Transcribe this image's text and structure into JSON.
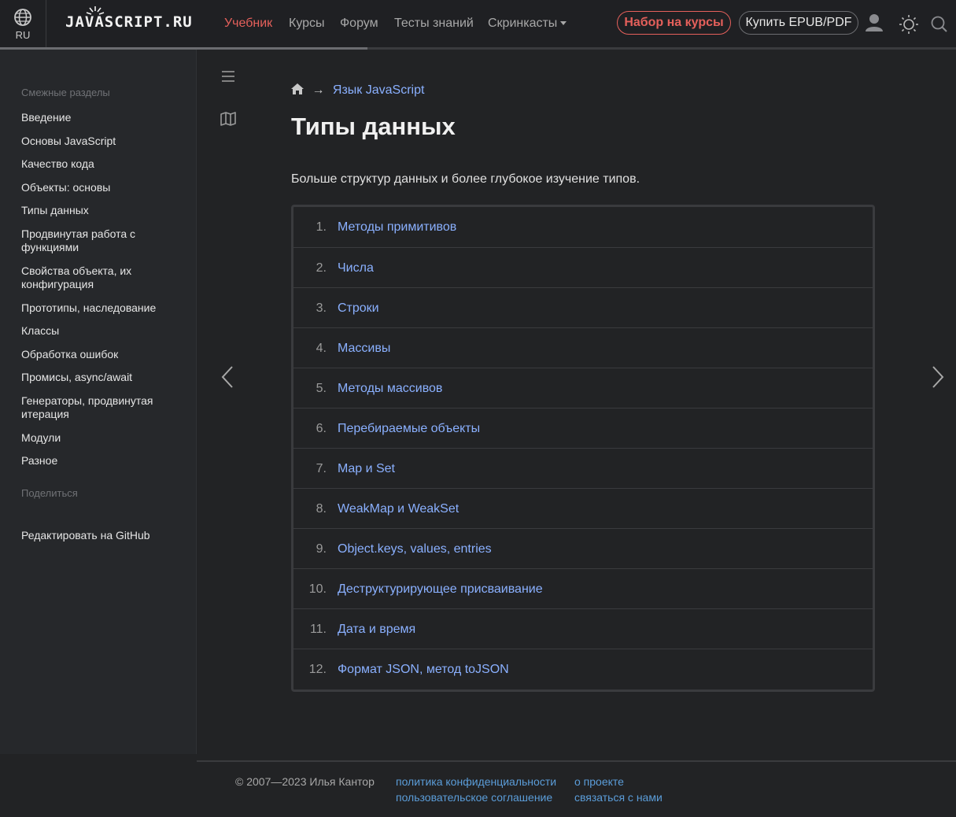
{
  "header": {
    "lang_code": "RU",
    "logo_text": "JAVASCRIPT.RU",
    "nav": [
      {
        "label": "Учебник",
        "active": true
      },
      {
        "label": "Курсы"
      },
      {
        "label": "Форум"
      },
      {
        "label": "Тесты знаний"
      },
      {
        "label": "Скринкасты"
      }
    ],
    "courses_button": "Набор на курсы",
    "buy_button": "Купить EPUB/PDF",
    "icons": [
      "globe-icon",
      "user-icon",
      "theme-sun-icon",
      "search-icon"
    ],
    "accent_color": "#e5605b"
  },
  "sidebar": {
    "related_title": "Смежные разделы",
    "items": [
      "Введение",
      "Основы JavaScript",
      "Качество кода",
      "Объекты: основы",
      "Типы данных",
      "Продвинутая работа с функциями",
      "Свойства объекта, их конфигурация",
      "Прототипы, наследование",
      "Классы",
      "Обработка ошибок",
      "Промисы, async/await",
      "Генераторы, продвинутая итерация",
      "Модули",
      "Разное"
    ],
    "share_title": "Поделиться",
    "edit_link": "Редактировать на GitHub"
  },
  "tools": {
    "icons": [
      "menu-icon",
      "map-icon",
      "prev-arrow-icon",
      "next-arrow-icon"
    ]
  },
  "main": {
    "breadcrumb": {
      "home_icon": "home-icon",
      "separator": "→",
      "link": "Язык JavaScript"
    },
    "title": "Типы данных",
    "intro": "Больше структур данных и более глубокое изучение типов.",
    "link_color": "#8ab0ff",
    "toc": [
      {
        "num": "1.",
        "label": "Методы примитивов"
      },
      {
        "num": "2.",
        "label": "Числа"
      },
      {
        "num": "3.",
        "label": "Строки"
      },
      {
        "num": "4.",
        "label": "Массивы"
      },
      {
        "num": "5.",
        "label": "Методы массивов"
      },
      {
        "num": "6.",
        "label": "Перебираемые объекты"
      },
      {
        "num": "7.",
        "label": "Map и Set"
      },
      {
        "num": "8.",
        "label": "WeakMap и WeakSet"
      },
      {
        "num": "9.",
        "label": "Object.keys, values, entries"
      },
      {
        "num": "10.",
        "label": "Деструктурирующее присваивание"
      },
      {
        "num": "11.",
        "label": "Дата и время"
      },
      {
        "num": "12.",
        "label": "Формат JSON, метод toJSON"
      }
    ]
  },
  "footer": {
    "copyright": "© 2007—2023  Илья Кантор",
    "links": [
      "политика конфиденциальности",
      "пользовательское соглашение",
      "о проекте",
      "связаться с нами"
    ]
  }
}
